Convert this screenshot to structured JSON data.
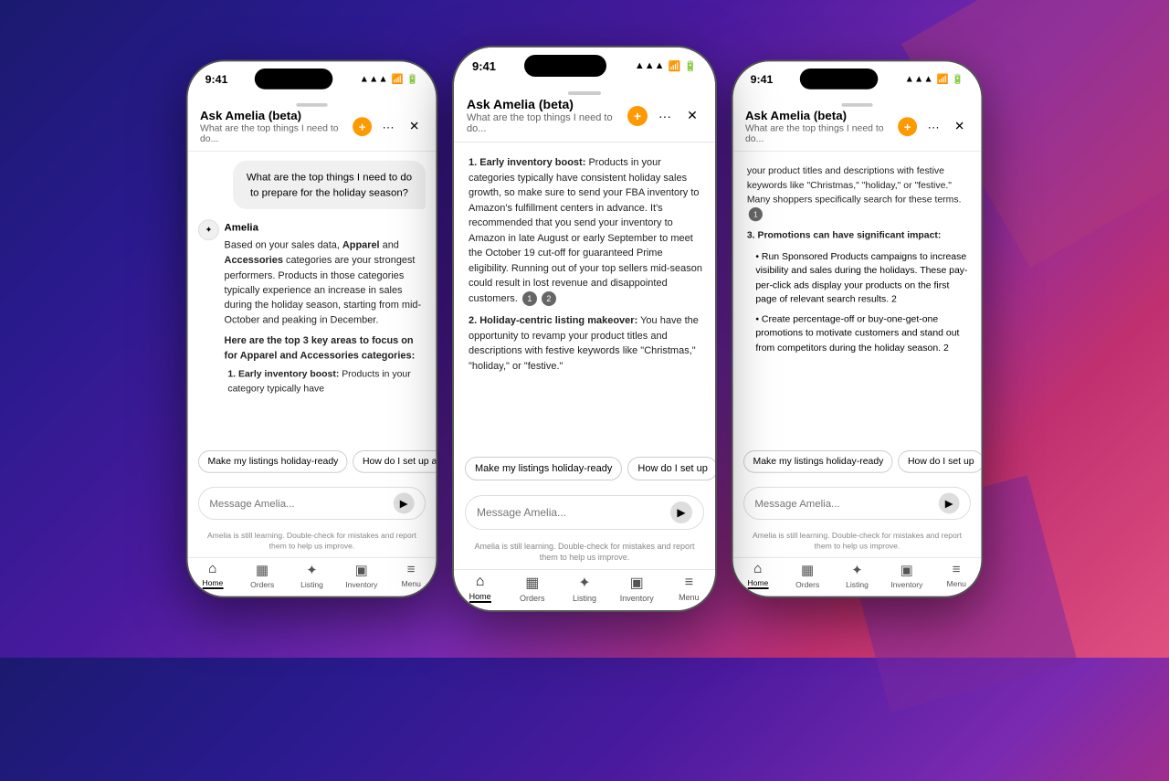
{
  "app": {
    "title": "Ask Amelia (beta)",
    "subtitle": "What are the top things I need to do...",
    "disclaimer": "Amelia is still learning. Double-check for mistakes and report them to help us improve."
  },
  "status_bar": {
    "time": "9:41",
    "signal": "▲▲▲",
    "wifi": "WiFi",
    "battery": "Battery"
  },
  "phone1": {
    "user_message": "What are the top things I need to do to prepare for the holiday season?",
    "amelia_name": "Amelia",
    "amelia_intro": "Based on your sales data, ",
    "amelia_bold1": "Apparel",
    "amelia_and": " and ",
    "amelia_bold2": "Accessories",
    "amelia_text1": " categories are your strongest performers. Products in those categories typically experience an increase in sales during the holiday season, starting from mid-October and peaking in December.",
    "amelia_header": "Here are the top 3 key areas to focus on for Apparel and Accessories categories:",
    "item1_title": "Early inventory boost:",
    "item1_text": " Products in your category typically have",
    "quick_reply1": "Make my listings holiday-ready",
    "quick_reply2": "How do I set up a",
    "input_placeholder": "Message Amelia...",
    "nav": {
      "home": "Home",
      "orders": "Orders",
      "listing": "Listing",
      "inventory": "Inventory",
      "menu": "Menu"
    },
    "active_nav": "home"
  },
  "phone2": {
    "item1_title": "Early inventory boost:",
    "item1_text": " Products in your categories typically have consistent holiday sales growth, so make sure to ",
    "item1_link": "send your FBA inventory",
    "item1_text2": " to Amazon's fulfillment centers in advance. It's recommended that you send your inventory to Amazon in late August or early September to meet the October 19 cut-off for guaranteed Prime eligibility. Running out of your top sellers mid-season could result in lost revenue and disappointed customers.",
    "badge1": "1",
    "badge2": "2",
    "item2_title": "Holiday-centric listing makeover:",
    "item2_text": " You have the opportunity to ",
    "item2_link": "revamp your product titles",
    "item2_text2": " and descriptions with festive keywords like \"Christmas,\" \"holiday,\" or \"festive.\"",
    "quick_reply1": "Make my listings holiday-ready",
    "quick_reply2": "How do I set up",
    "input_placeholder": "Message Amelia...",
    "nav": {
      "home": "Home",
      "orders": "Orders",
      "listing": "Listing",
      "inventory": "Inventory",
      "menu": "Menu"
    },
    "active_nav": "home"
  },
  "phone3": {
    "text_link1": "your product titles",
    "text1": " and descriptions with festive keywords like \"Christmas,\" \"holiday,\" or \"festive.\" Many shoppers specifically search for these terms.",
    "badge1": "1",
    "item3_title": "Promotions can have significant impact:",
    "bullet1_link": "Sponsored Products",
    "bullet1_text": " campaigns to increase visibility and sales during the holidays. These pay-per-click ads display your products on the first page of relevant search results.",
    "badge2": "2",
    "bullet2_link": "Create percentage-off or buy-one-get-one promotions",
    "bullet2_text": " to motivate customers and stand out from competitors during the holiday season.",
    "badge3": "2",
    "quick_reply1": "Make my listings holiday-ready",
    "quick_reply2": "How do I set up",
    "input_placeholder": "Message Amelia...",
    "nav": {
      "home": "Home",
      "orders": "Orders",
      "listing": "Listing",
      "inventory": "Inventory",
      "menu": "Menu"
    },
    "active_nav": "home"
  }
}
